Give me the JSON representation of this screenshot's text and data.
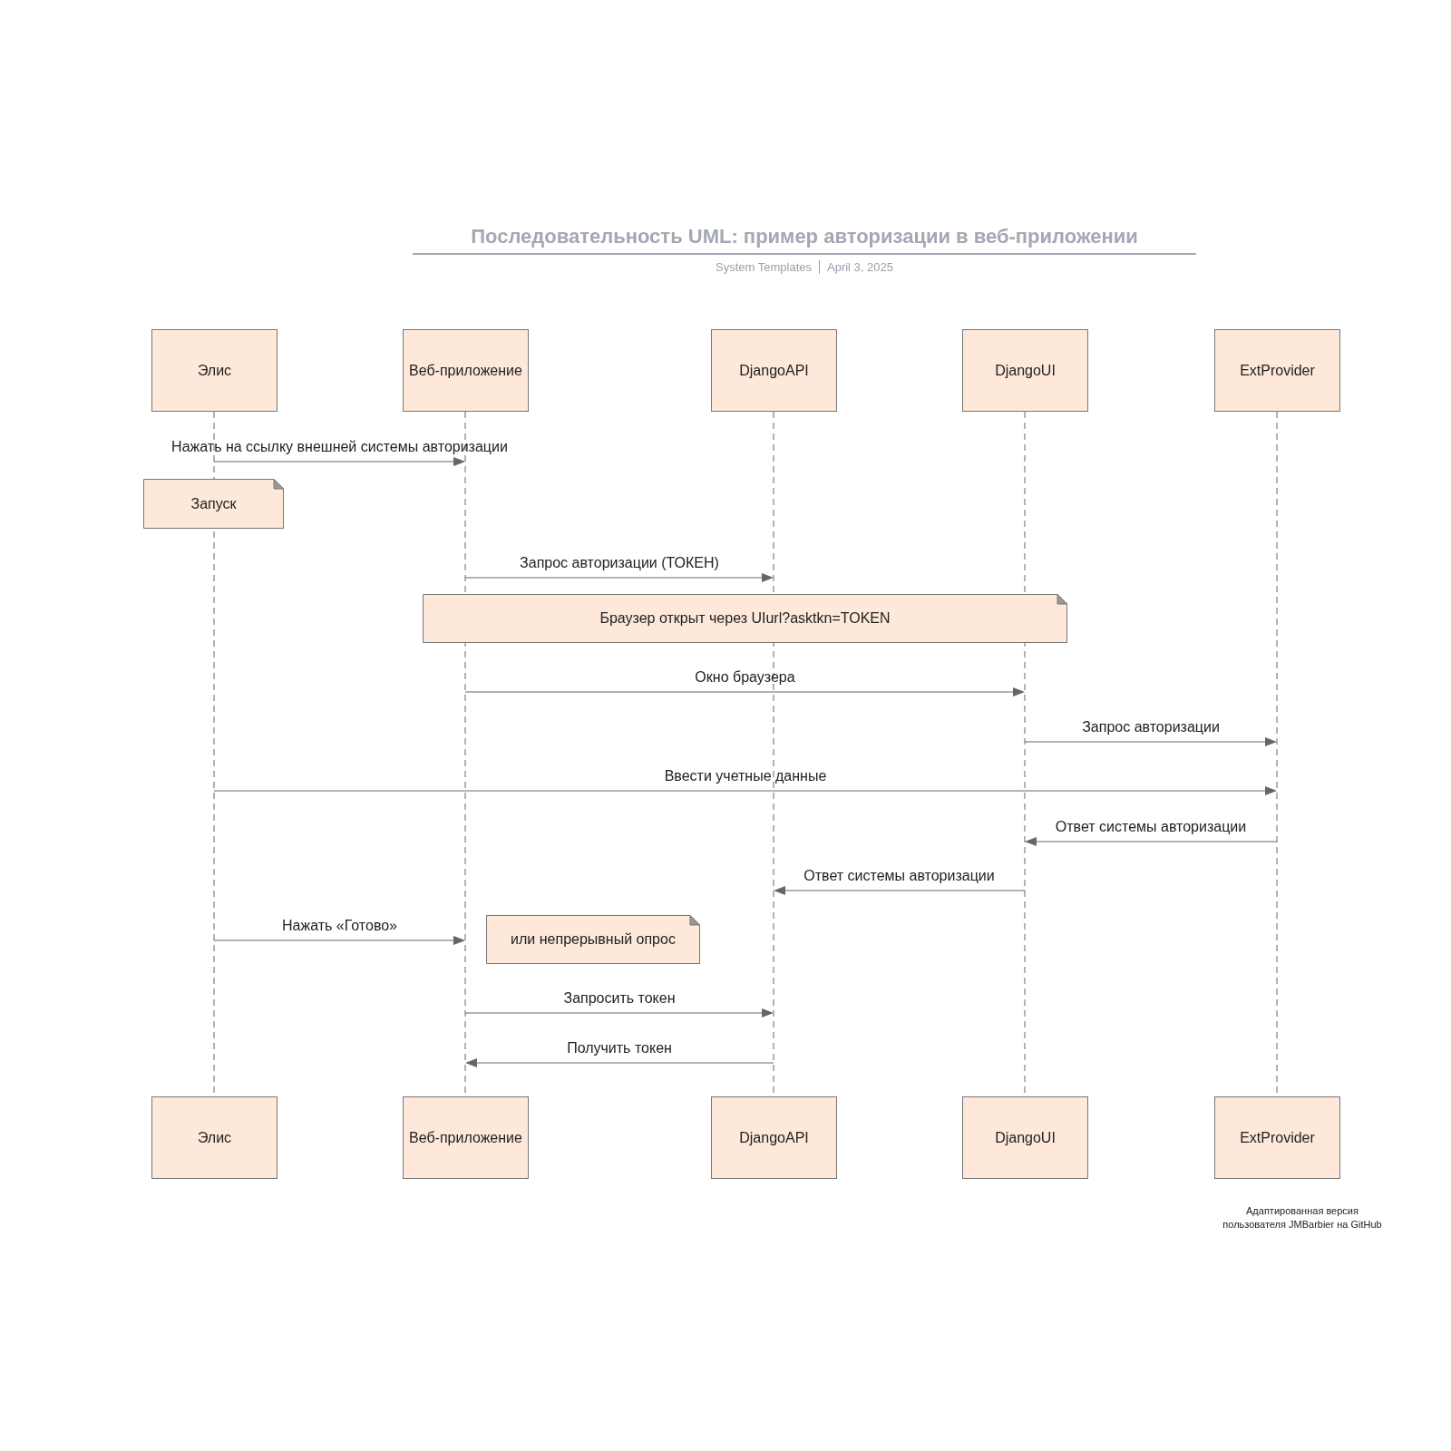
{
  "title": "Последовательность UML: пример авторизации в веб-приложении",
  "subtitle": {
    "author": "System Templates",
    "date": "April 3, 2025"
  },
  "participants_top": [
    "Элис",
    "Веб-приложение",
    "DjangoAPI",
    "DjangoUI",
    "ExtProvider"
  ],
  "participants_bottom": [
    "Элис",
    "Веб-приложение",
    "DjangoAPI",
    "DjangoUI",
    "ExtProvider"
  ],
  "events": [
    {
      "kind": "message",
      "label": "Нажать на ссылку внешней системы авторизации"
    },
    {
      "kind": "note",
      "text": "Запуск"
    },
    {
      "kind": "message",
      "label": "Запрос авторизации (ТОКЕН)"
    },
    {
      "kind": "note",
      "text": "Браузер открыт через UIurl?asktkn=TOKEN"
    },
    {
      "kind": "message",
      "label": "Окно браузера"
    },
    {
      "kind": "message",
      "label": "Запрос авторизации"
    },
    {
      "kind": "message",
      "label": "Ввести учетные данные"
    },
    {
      "kind": "message",
      "label": "Ответ системы авторизации"
    },
    {
      "kind": "message",
      "label": "Ответ системы авторизации"
    },
    {
      "kind": "message",
      "label": "Нажать «Готово»"
    },
    {
      "kind": "note",
      "text": "или непрерывный опрос"
    },
    {
      "kind": "message",
      "label": "Запросить токен"
    },
    {
      "kind": "message",
      "label": "Получить токен"
    }
  ],
  "credit": "Адаптированная версия\nпользователя JMBarbier на GitHub"
}
